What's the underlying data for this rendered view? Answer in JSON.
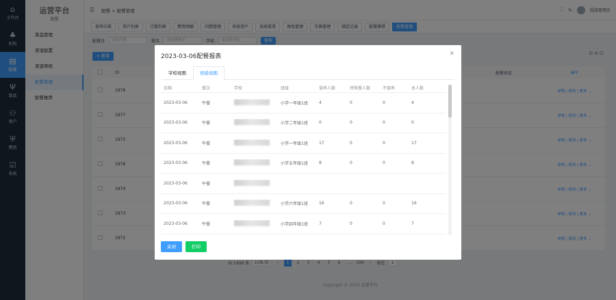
{
  "app": {
    "brand_title": "运营平台",
    "brand_sub": "配餐"
  },
  "leftbar": [
    {
      "icon": "⌂",
      "label": "工作台"
    },
    {
      "icon": "♣",
      "label": "机构"
    },
    {
      "icon": "▤",
      "label": "配餐"
    },
    {
      "icon": "Ψ",
      "label": "菜品"
    },
    {
      "icon": "⚇",
      "label": "用户"
    },
    {
      "icon": "⛨",
      "label": "费用"
    },
    {
      "icon": "☑",
      "label": "系统"
    }
  ],
  "sidebar": [
    "菜品管理",
    "菜谱配置",
    "菜谱审核",
    "配餐管理",
    "配餐推荐"
  ],
  "topbar": {
    "breadcrumb": "配餐  >  配餐管理",
    "user": "超级管理员"
  },
  "tags": [
    "发布中菜",
    "用户列表",
    "订餐列表",
    "费用明细",
    "问题管理",
    "系统用户",
    "系统菜单",
    "角色管理",
    "字典管理",
    "绑定记录",
    "配餐推荐",
    "配餐管理"
  ],
  "filter": {
    "label1": "配餐日",
    "ph1": "选择日期",
    "label2": "餐次",
    "ph2": "请选择餐次",
    "label3": "学校",
    "ph3": "请选择学校",
    "search": "搜索"
  },
  "add_button": "+ 新增",
  "bg_table": {
    "headers": {
      "id": "ID",
      "col": "配餐状态",
      "ops": "操作"
    },
    "ids": [
      "1976",
      "1977",
      "1975",
      "1976",
      "1974",
      "1973",
      "1972"
    ],
    "ops": "详情 | 修改 | 更多 ⌄"
  },
  "pager": {
    "total": "共 1998 条",
    "size": "10条/页",
    "pages": [
      "1",
      "2",
      "3",
      "4",
      "5",
      "6",
      "...",
      "198"
    ],
    "goto": "前往",
    "page": "1"
  },
  "footer": "Copyright © 2023 运营平台",
  "modal": {
    "title": "2023-03-06配餐报表",
    "tabs": [
      "学校视图",
      "班级视图"
    ],
    "headers": [
      "日期",
      "餐次",
      "学校",
      "班级",
      "营养人数",
      "特殊餐人数",
      "不营养",
      "总人数"
    ],
    "rows": [
      [
        "2023-03-06",
        "午餐",
        "",
        "小学一年级1班",
        "4",
        "0",
        "0",
        "4"
      ],
      [
        "2023-03-06",
        "午餐",
        "",
        "小学二年级1班",
        "0",
        "0",
        "0",
        "0"
      ],
      [
        "2023-03-06",
        "午餐",
        "",
        "小学一年级1班",
        "17",
        "0",
        "0",
        "17"
      ],
      [
        "2023-03-06",
        "午餐",
        "",
        "小学五年级1班",
        "8",
        "0",
        "0",
        "8"
      ],
      [
        "2023-03-06",
        "午餐",
        "",
        "",
        "",
        "",
        "",
        ""
      ],
      [
        "2023-03-06",
        "午餐",
        "",
        "小学六年级1班",
        "16",
        "0",
        "0",
        "16"
      ],
      [
        "2023-03-06",
        "午餐",
        "",
        "小学四年级1班",
        "7",
        "0",
        "0",
        "7"
      ]
    ],
    "buttons": {
      "close": "关闭",
      "print": "打印"
    }
  }
}
